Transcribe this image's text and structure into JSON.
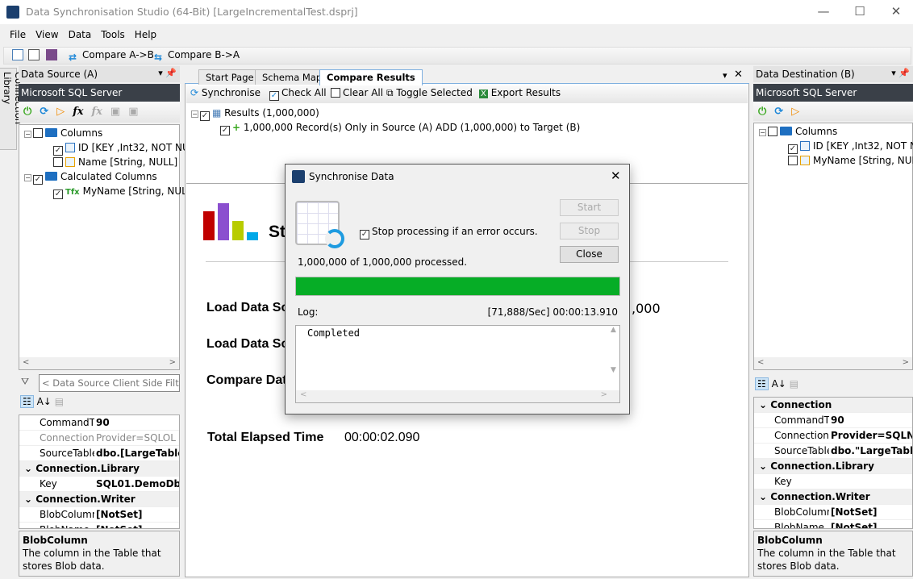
{
  "window": {
    "title": "Data Synchronisation Studio (64-Bit) [LargeIncrementalTest.dsprj]",
    "minimize": "—",
    "maximize": "☐",
    "close": "✕"
  },
  "menu": [
    "File",
    "View",
    "Data",
    "Tools",
    "Help"
  ],
  "toolbar": {
    "compare_ab": "Compare A->B",
    "compare_ba": "Compare B->A"
  },
  "connection_library": "Connection Library",
  "source": {
    "title": "Data Source (A)",
    "provider": "Microsoft SQL Server",
    "tree": {
      "columns": "Columns",
      "id": "ID [KEY ,Int32, NOT NU",
      "name": "Name [String, NULL]",
      "calculated": "Calculated Columns",
      "myname": "MyName [String, NULL"
    },
    "filter_placeholder": "< Data Source Client Side Filter E",
    "props": [
      {
        "k": "CommandT",
        "v": "90"
      },
      {
        "k": "Connection!",
        "v": "Provider=SQLOL",
        "dim": true
      },
      {
        "k": "SourceTable",
        "v": "dbo.[LargeTable"
      },
      {
        "cat": "Connection.Library"
      },
      {
        "k": "Key",
        "v": "SQL01.DemoDb"
      },
      {
        "cat": "Connection.Writer"
      },
      {
        "k": "BlobColumn",
        "v": "[NotSet]"
      },
      {
        "k": "BlobName",
        "v": "[NotSet]"
      }
    ],
    "desc_title": "BlobColumn",
    "desc_text": "The column in the Table that stores Blob data."
  },
  "destination": {
    "title": "Data Destination (B)",
    "provider": "Microsoft SQL Server",
    "tree": {
      "columns": "Columns",
      "id": "ID [KEY ,Int32, NOT NU",
      "myname": "MyName [String, NULL"
    },
    "props": [
      {
        "cat": "Connection"
      },
      {
        "k": "CommandT",
        "v": "90"
      },
      {
        "k": "Connection!",
        "v": "Provider=SQLN"
      },
      {
        "k": "SourceTable",
        "v": "dbo.\"LargeTable"
      },
      {
        "cat": "Connection.Library"
      },
      {
        "k": "Key",
        "v": ""
      },
      {
        "cat": "Connection.Writer"
      },
      {
        "k": "BlobColumn",
        "v": "[NotSet]"
      },
      {
        "k": "BlobName",
        "v": "[NotSet]"
      }
    ],
    "desc_title": "BlobColumn",
    "desc_text": "The column in the Table that stores Blob data."
  },
  "tabs": [
    "Start Page",
    "Schema Map",
    "Compare Results"
  ],
  "results_toolbar": {
    "sync": "Synchronise",
    "check_all": "Check All",
    "clear_all": "Clear All",
    "toggle": "Toggle Selected",
    "export": "Export Results"
  },
  "results": {
    "root": "Results (1,000,000)",
    "child": "1,000,000 Record(s) Only in Source (A) ADD (1,000,000) to Target (B)"
  },
  "summary": {
    "heading": "St",
    "rows": [
      {
        "label": "Load Data So",
        "value": ",000"
      },
      {
        "label": "Load Data So",
        "value": ""
      },
      {
        "label": "Compare Dat",
        "value": ""
      }
    ],
    "total_label": "Total Elapsed Time",
    "total_value": "00:00:02.090",
    "logo_colors": [
      "#c00000",
      "#8b4fcf",
      "#b8cc00",
      "#00a8e8"
    ]
  },
  "dialog": {
    "title": "Synchronise Data",
    "stop_on_error": "Stop processing if an error occurs.",
    "stop_on_error_checked": true,
    "processed": "1,000,000 of 1,000,000 processed.",
    "progress_percent": 100,
    "progress_color": "#06ad26",
    "log_label": "Log:",
    "rate": "[71,888/Sec] 00:00:13.910",
    "log_text": "Completed",
    "start": "Start",
    "stop": "Stop",
    "close": "Close"
  }
}
